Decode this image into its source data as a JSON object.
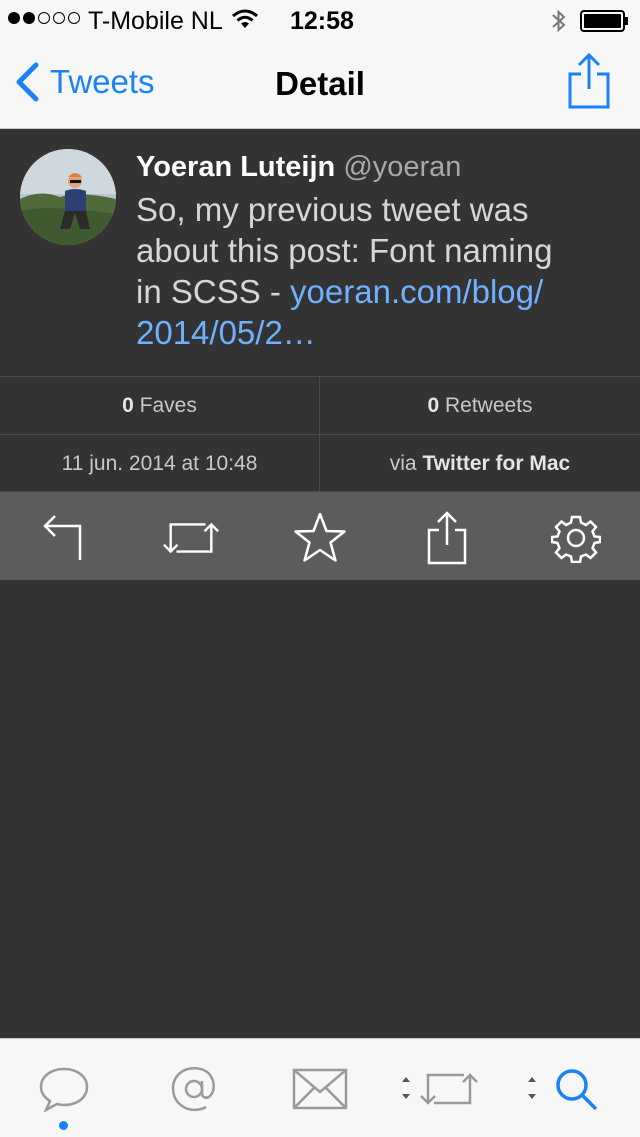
{
  "status_bar": {
    "carrier": "T-Mobile NL",
    "time": "12:58",
    "signal_bars_filled": 2,
    "signal_bars_total": 5
  },
  "nav": {
    "back_label": "Tweets",
    "title": "Detail"
  },
  "tweet": {
    "author_name": "Yoeran Luteijn",
    "author_handle": "@yoeran",
    "text_line1": "So, my previous tweet was",
    "text_line2": "about this post: Font naming",
    "text_line3_prefix": "in SCSS - ",
    "link_part1": "yoeran.com/blog/",
    "link_part2": "2014/05/2…"
  },
  "stats": {
    "faves_count": "0",
    "faves_label": " Faves",
    "retweets_count": "0",
    "retweets_label": " Retweets",
    "date": "11 jun. 2014 at 10:48",
    "via_prefix": "via ",
    "via_client": "Twitter for Mac"
  },
  "colors": {
    "accent": "#1a82f7",
    "link": "#6fb0ff",
    "background": "#333333",
    "toolbar": "#5c5c5c",
    "bars": "#f7f7f7"
  },
  "icons": {
    "actions": [
      "reply-icon",
      "retweet-icon",
      "favorite-star-icon",
      "share-icon",
      "settings-gear-icon"
    ],
    "tabs": [
      "timeline-bubble-icon",
      "mentions-at-icon",
      "messages-envelope-icon",
      "retweets-icon",
      "search-icon"
    ],
    "active_tab": "search-icon"
  }
}
